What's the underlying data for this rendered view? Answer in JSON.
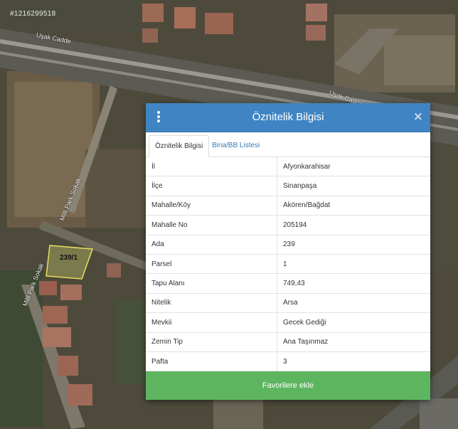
{
  "map": {
    "image_id": "#1216299518",
    "road_labels": [
      "Uşak Cadde",
      "Uşak Cadde",
      "Milli Park Sokak",
      "Milli Park Sokak"
    ],
    "parcel_label": "239/1"
  },
  "dialog": {
    "title": "Öznitelik Bilgisi",
    "close_symbol": "×",
    "tabs": [
      {
        "label": "Öznitelik Bilgisi",
        "active": true
      },
      {
        "label": "Bina/BB Listesi",
        "active": false
      }
    ],
    "rows": [
      {
        "key": "İl",
        "value": "Afyonkarahisar"
      },
      {
        "key": "İlçe",
        "value": "Sinanpaşa"
      },
      {
        "key": "Mahalle/Köy",
        "value": "Akören/Bağdat"
      },
      {
        "key": "Mahalle No",
        "value": "205194"
      },
      {
        "key": "Ada",
        "value": "239"
      },
      {
        "key": "Parsel",
        "value": "1"
      },
      {
        "key": "Tapu Alanı",
        "value": "749,43"
      },
      {
        "key": "Nitelik",
        "value": "Arsa"
      },
      {
        "key": "Mevkii",
        "value": "Gecek Gediği"
      },
      {
        "key": "Zemin Tip",
        "value": "Ana Taşınmaz"
      },
      {
        "key": "Pafta",
        "value": "3"
      }
    ],
    "favorite_button": "Favorilere ekle"
  },
  "colors": {
    "header": "#3f85c3",
    "button": "#5db560",
    "tab_link": "#3a78b5"
  }
}
